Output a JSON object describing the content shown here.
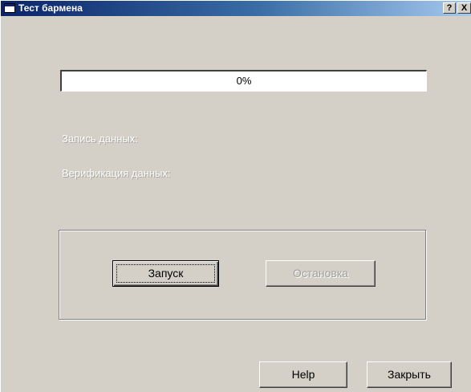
{
  "window": {
    "title": "Тест бармена",
    "help_glyph": "?",
    "close_glyph": "X"
  },
  "progress": {
    "value": 0,
    "text": "0%"
  },
  "status": {
    "write_label": "Запись данных:",
    "verify_label": "Верификация данных:"
  },
  "buttons": {
    "start": "Запуск",
    "stop": "Остановка",
    "help": "Help",
    "close": "Закрыть"
  },
  "colors": {
    "title_active": "#0a246a",
    "face": "#d4d0c8"
  },
  "icons": {
    "app": "window-app-icon"
  }
}
